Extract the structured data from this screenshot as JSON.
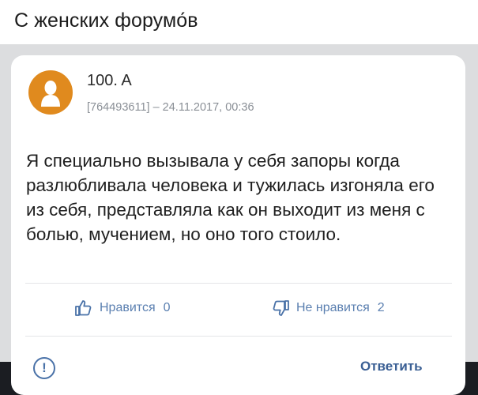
{
  "caption": "С женских форумо́в",
  "post": {
    "author": "100. A",
    "meta": "[764493611] – 24.11.2017, 00:36",
    "text": "Я специально вызывала у себя запоры когда разлюбливала человека и тужилась изгоняла его из себя, представляла как он выходит из меня с болью, мучением, но оно того стоило."
  },
  "reactions": {
    "like_label": "Нравится",
    "like_count": "0",
    "dislike_label": "Не нравится",
    "dislike_count": "2"
  },
  "actions": {
    "report_symbol": "!",
    "reply_label": "Ответить"
  },
  "colors": {
    "avatar": "#e08a1e",
    "accent": "#3a5f94"
  },
  "icons": [
    "avatar-silhouette-icon",
    "thumbs-up-icon",
    "thumbs-down-icon",
    "report-icon"
  ]
}
